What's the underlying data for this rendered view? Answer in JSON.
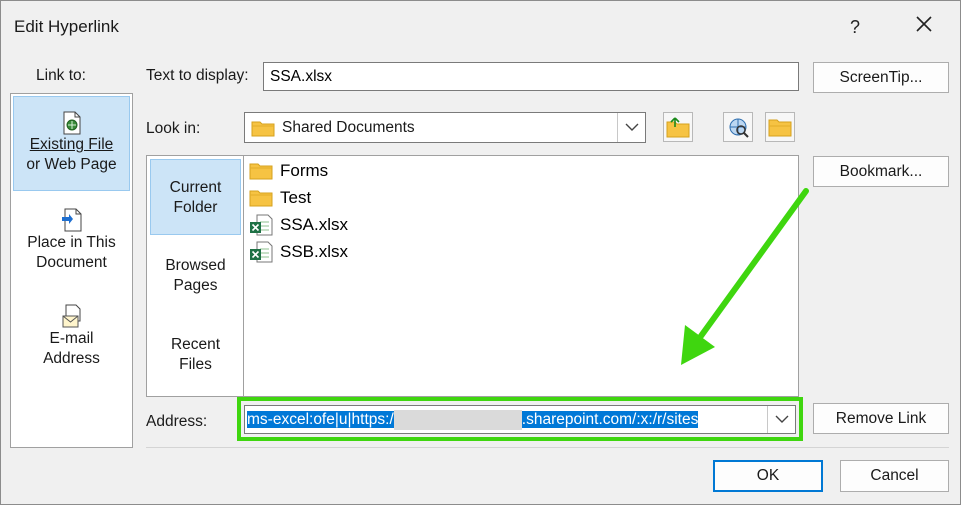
{
  "dialog": {
    "title": "Edit Hyperlink",
    "help_label": "?",
    "close_label": "✕"
  },
  "link_to": {
    "label": "Link to:",
    "items": [
      {
        "line1": "Existing File",
        "line2": "or Web Page",
        "icon": "existing-file-icon",
        "selected": true
      },
      {
        "line1": "Place in This",
        "line2": "Document",
        "icon": "place-in-document-icon",
        "selected": false
      },
      {
        "line1": "E-mail",
        "line2": "Address",
        "icon": "email-icon",
        "selected": false
      }
    ]
  },
  "text_to_display": {
    "label": "Text to display:",
    "value": "SSA.xlsx"
  },
  "screentip_button": "ScreenTip...",
  "look_in": {
    "label": "Look in:",
    "value": "Shared Documents",
    "icon": "folder-icon"
  },
  "toolbar_icons": [
    "up-one-folder-icon",
    "browse-web-icon",
    "browse-file-icon"
  ],
  "nav": [
    {
      "line1": "Current",
      "line2": "Folder",
      "selected": true
    },
    {
      "line1": "Browsed",
      "line2": "Pages",
      "selected": false
    },
    {
      "line1": "Recent",
      "line2": "Files",
      "selected": false
    }
  ],
  "files": [
    {
      "name": "Forms",
      "type": "folder"
    },
    {
      "name": "Test",
      "type": "folder"
    },
    {
      "name": "SSA.xlsx",
      "type": "excel"
    },
    {
      "name": "SSB.xlsx",
      "type": "excel"
    }
  ],
  "bookmark_button": "Bookmark...",
  "address": {
    "label": "Address:",
    "value_part1": "ms-excel:ofe|u|https:/",
    "value_part2": ".sharepoint.com/:x:/r/sites"
  },
  "remove_link_button": "Remove Link",
  "ok_button": "OK",
  "cancel_button": "Cancel",
  "colors": {
    "highlight_box": "#3fd60f",
    "arrow": "#3fd60f",
    "selection": "#0078d7",
    "selected_item_bg": "#cce4f7"
  }
}
